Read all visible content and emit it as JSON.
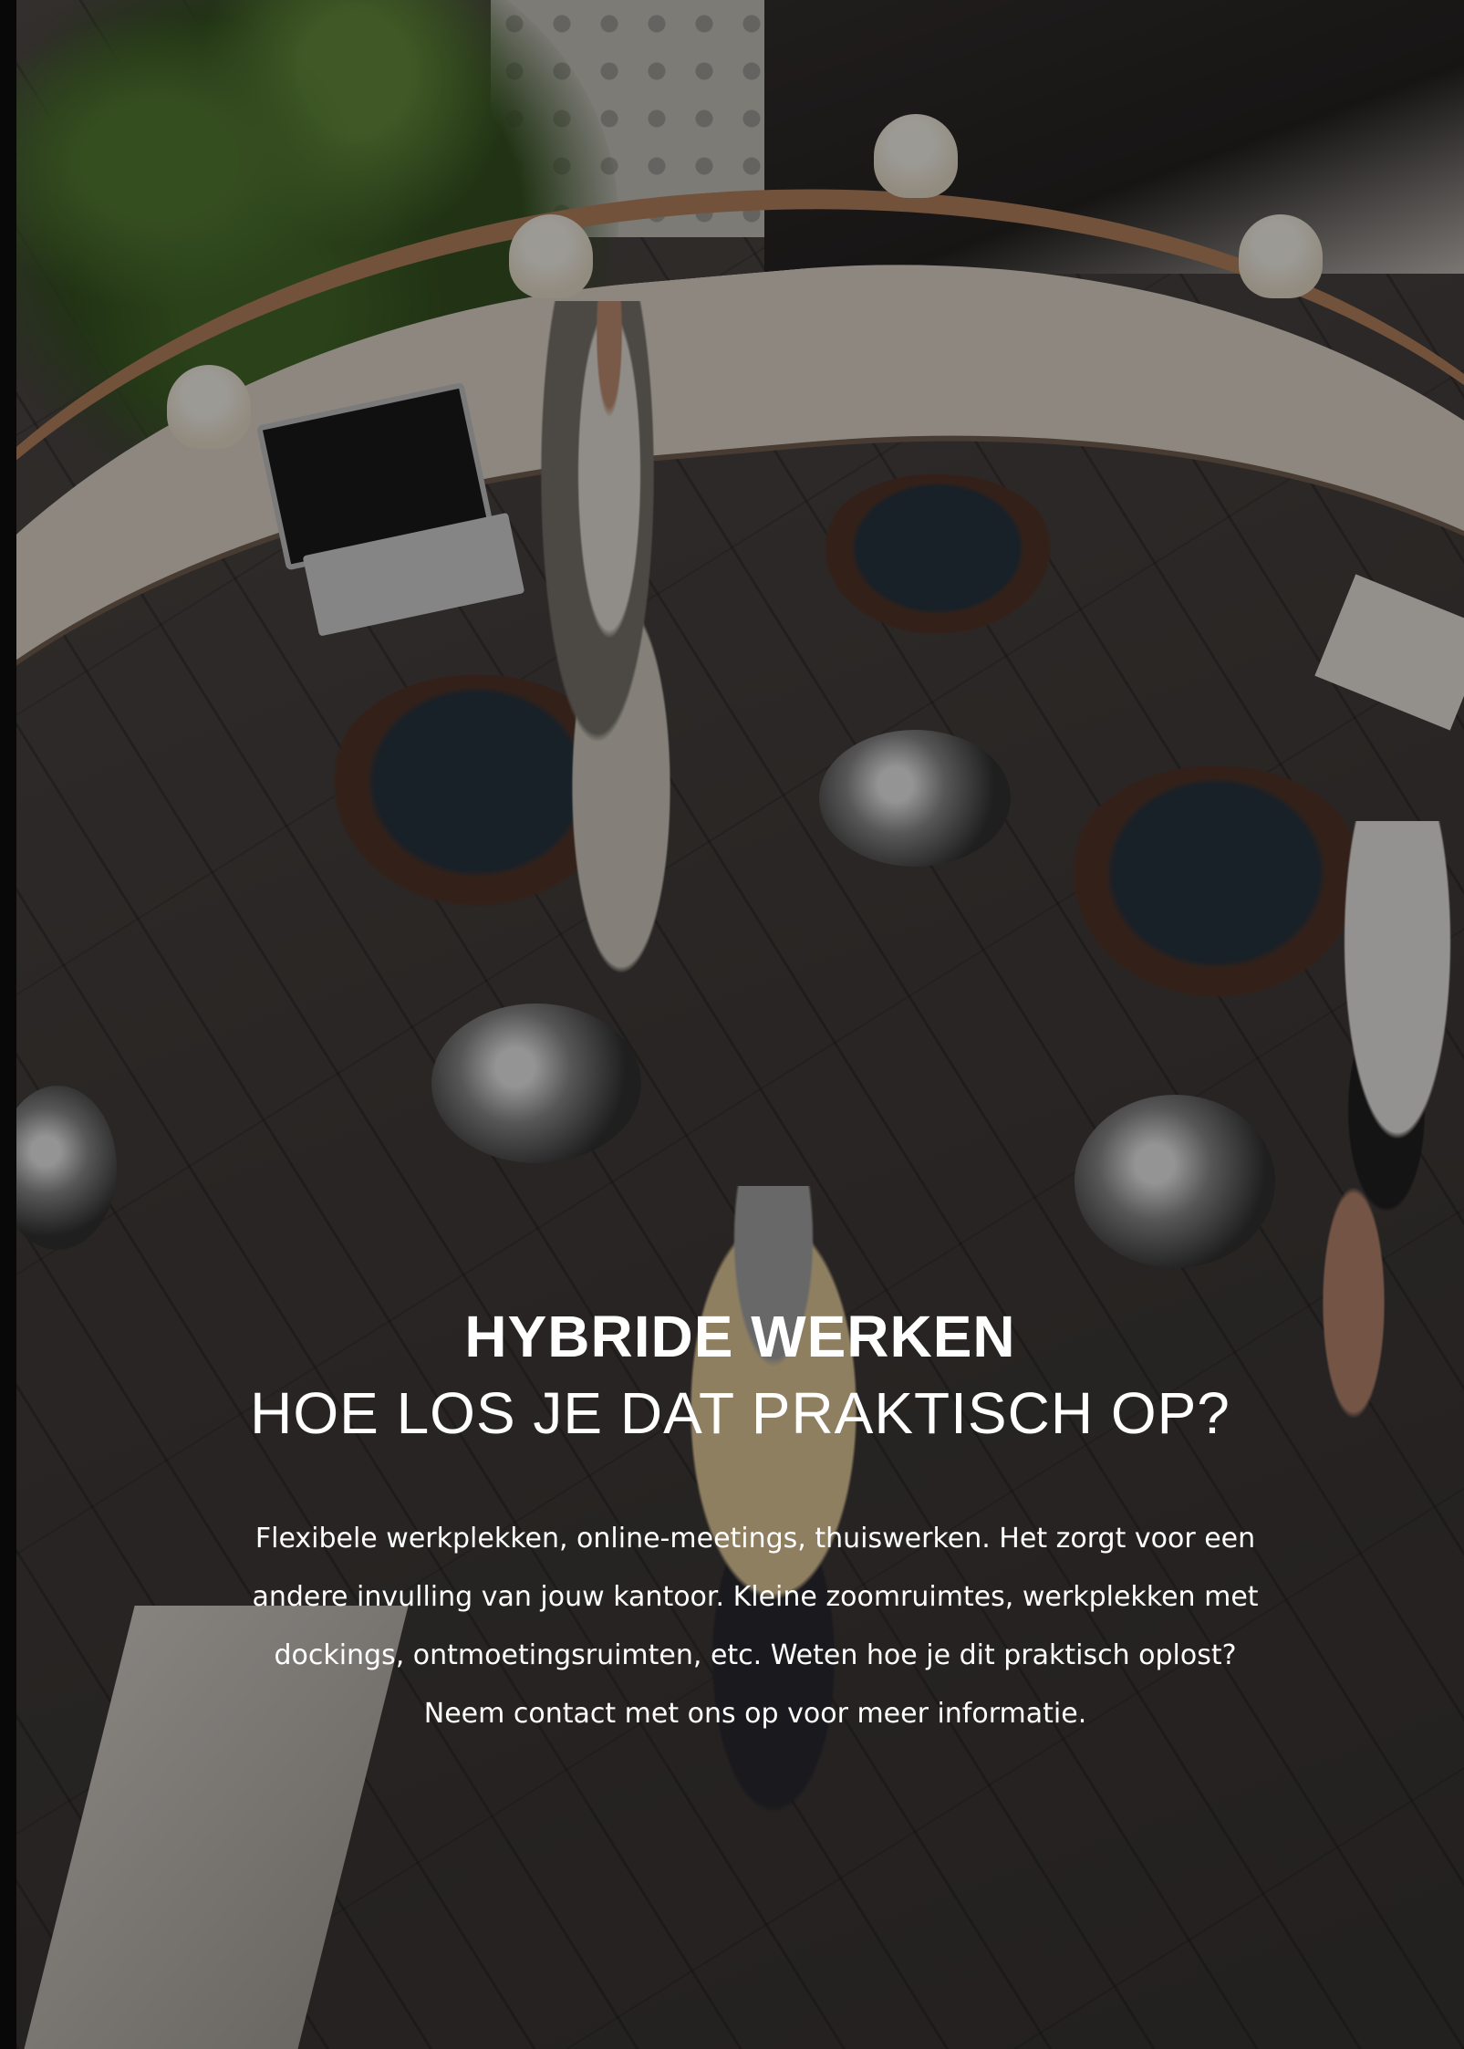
{
  "headline": "HYBRIDE WERKEN",
  "subheadline": "HOE LOS JE DAT PRAKTISCH OP?",
  "body_lines": [
    "Flexibele werkplekken, online-meetings, thuiswerken. Het zorgt voor een",
    "andere invulling van jouw kantoor. Kleine zoomruimtes, werkplekken met",
    "dockings, ontmoetingsruimten, etc. Weten hoe je dit praktisch oplost?",
    "Neem contact met ons op voor meer informatie."
  ]
}
